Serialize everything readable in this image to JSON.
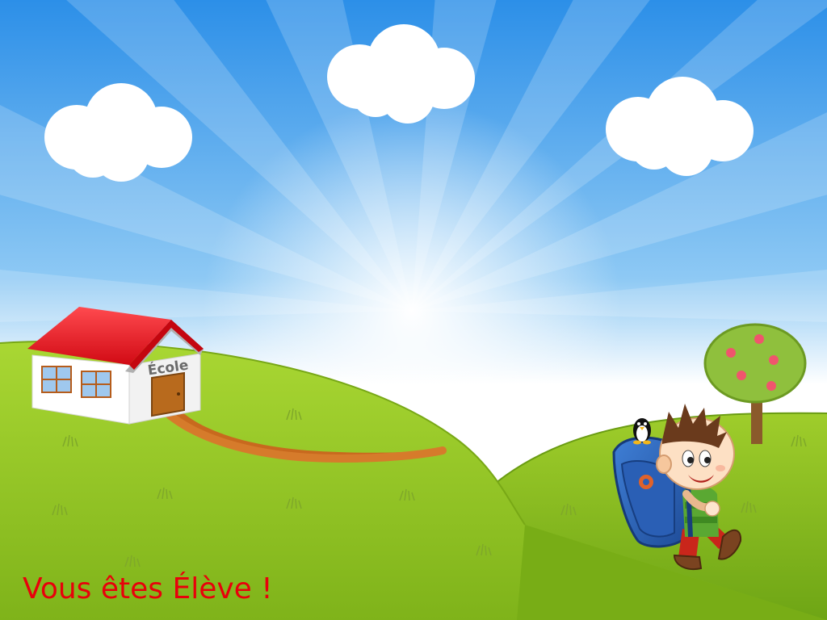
{
  "scene": {
    "school_label": "École",
    "caption": "Vous êtes Élève !"
  },
  "colors": {
    "sky_top": "#2f93ea",
    "sky_bottom": "#ffffff",
    "hill_green": "#9ccf1f",
    "roof_red": "#e5111c",
    "door_brown": "#b86a1d",
    "path_orange": "#c96b1e",
    "caption_red": "#e8000b"
  },
  "icons": [
    "cloud",
    "school-house",
    "apple-tree",
    "boy-with-backpack",
    "penguin"
  ]
}
